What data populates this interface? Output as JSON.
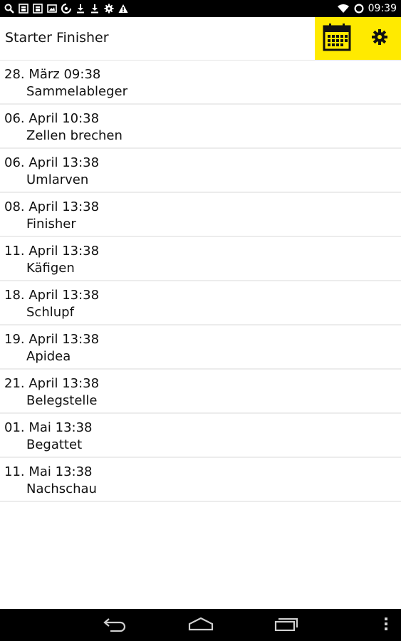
{
  "status_bar": {
    "left_icons": [
      "search-icon",
      "notification-icon",
      "notification-icon-2",
      "image-icon",
      "sync-icon",
      "download-icon",
      "download-icon-2",
      "android-icon",
      "warning-icon"
    ],
    "right_icons": [
      "wifi-icon",
      "battery-icon"
    ],
    "time": "09:39"
  },
  "action_bar": {
    "title": "Starter Finisher",
    "accent_color": "#ffea00",
    "buttons": [
      "calendar-icon",
      "gear-icon"
    ]
  },
  "schedule": [
    {
      "date": "28. März 09:38",
      "label": "Sammelableger"
    },
    {
      "date": "06. April 10:38",
      "label": "Zellen brechen"
    },
    {
      "date": "06. April 13:38",
      "label": "Umlarven"
    },
    {
      "date": "08. April 13:38",
      "label": "Finisher"
    },
    {
      "date": "11. April 13:38",
      "label": "Käfigen"
    },
    {
      "date": "18. April 13:38",
      "label": "Schlupf"
    },
    {
      "date": "19. April 13:38",
      "label": "Apidea"
    },
    {
      "date": "21. April 13:38",
      "label": "Belegstelle"
    },
    {
      "date": "01. Mai 13:38",
      "label": "Begattet"
    },
    {
      "date": "11. Mai 13:38",
      "label": "Nachschau"
    }
  ],
  "nav_bar": {
    "buttons": [
      "back-icon",
      "home-icon",
      "recents-icon",
      "overflow-menu-icon"
    ]
  }
}
